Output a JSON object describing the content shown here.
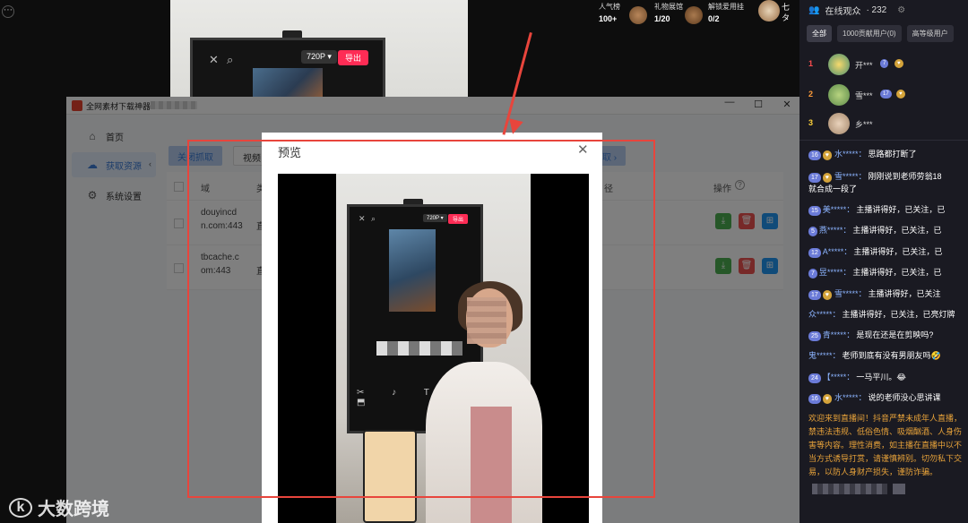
{
  "stream": {
    "stats": [
      {
        "label": "人气榜",
        "value": "100+"
      },
      {
        "label": "礼物展馆",
        "value": "1/20"
      },
      {
        "label": "解锁爱用挂",
        "value": "0/2"
      }
    ],
    "top_right_text": "七\nタ",
    "bg_monitor": {
      "resolution": "720P ▾",
      "export": "导出",
      "close": "✕",
      "search": "⌕"
    }
  },
  "app": {
    "title": "全网素材下载神器-",
    "win_min": "—",
    "win_max": "☐",
    "win_close": "✕",
    "sidebar": [
      {
        "label": "首页",
        "icon": "home-icon",
        "glyph": "⌂"
      },
      {
        "label": "获取资源",
        "icon": "cloud-icon",
        "glyph": "☁"
      },
      {
        "label": "系统设置",
        "icon": "gear-icon",
        "glyph": "⚙"
      }
    ],
    "collapse": "‹",
    "toolbar": {
      "close_capture": "关闭抓取",
      "video": "视频",
      "right_btn": "取 ›"
    },
    "table": {
      "headers": {
        "domain": "域",
        "type": "类",
        "path": "径",
        "op": "操作",
        "op_help": "?"
      },
      "rows": [
        {
          "domain": "douyincdn.com:443",
          "type": "直"
        },
        {
          "domain": "tbcache.com:443",
          "type": "直"
        }
      ]
    }
  },
  "modal": {
    "title": "预览",
    "close": "✕",
    "video": {
      "resolution": "720P ▾",
      "export": "导出",
      "tools": "✂ ♪ T ⬒"
    }
  },
  "watermark": {
    "logo": "k",
    "text": "大数跨境"
  },
  "panel": {
    "header": {
      "title": "在线观众",
      "count": "· 232",
      "settings": "⚙"
    },
    "tabs": [
      "全部",
      "1000贡献用户(0)",
      "高等级用户"
    ],
    "ranks": [
      {
        "no": "1",
        "name": "开***",
        "level": "7"
      },
      {
        "no": "2",
        "name": "雪***",
        "level": "17"
      },
      {
        "no": "3",
        "name": "乡***",
        "level": ""
      }
    ],
    "chat": [
      {
        "lv": "16",
        "nick": "水*****：",
        "text": "思路都打断了"
      },
      {
        "lv": "17",
        "nick": "雪*****：",
        "text": "刚刚说到老师劳翁18"
      },
      {
        "lv": "",
        "nick": "",
        "text": "就合成一段了"
      },
      {
        "lv": "15",
        "nick": "美*****：",
        "text": "主播讲得好，已关注，已"
      },
      {
        "lv": "5",
        "nick": "燕*****：",
        "text": "主播讲得好，已关注，已"
      },
      {
        "lv": "12",
        "nick": "A*****：",
        "text": "主播讲得好，已关注，已"
      },
      {
        "lv": "7",
        "nick": "昱*****：",
        "text": "主播讲得好，已关注，已"
      },
      {
        "lv": "17",
        "nick": "雪*****：",
        "text": "主播讲得好，已关注"
      },
      {
        "lv": "",
        "nick": "众*****：",
        "text": "主播讲得好，已关注，已亮灯牌"
      },
      {
        "lv": "25",
        "nick": "青*****：",
        "text": "是现在还是在剪映吗?"
      },
      {
        "lv": "",
        "nick": "鬼*****：",
        "text": "老师到底有没有男朋友吗🤣"
      },
      {
        "lv": "24",
        "nick": "【*****：",
        "text": "一马平川。😂"
      },
      {
        "lv": "16",
        "nick": "水*****：",
        "text": "说的老师没心思讲课"
      }
    ],
    "notice": "欢迎来到直播间！抖音严禁未成年人直播，禁违法违规、低俗色情、吸烟酗酒、人身伤害等内容。理性消费，如主播在直播中以不当方式诱导打赏，请谨慎辨别。切勿私下交易，以防人身财产损失，谨防诈骗。"
  }
}
